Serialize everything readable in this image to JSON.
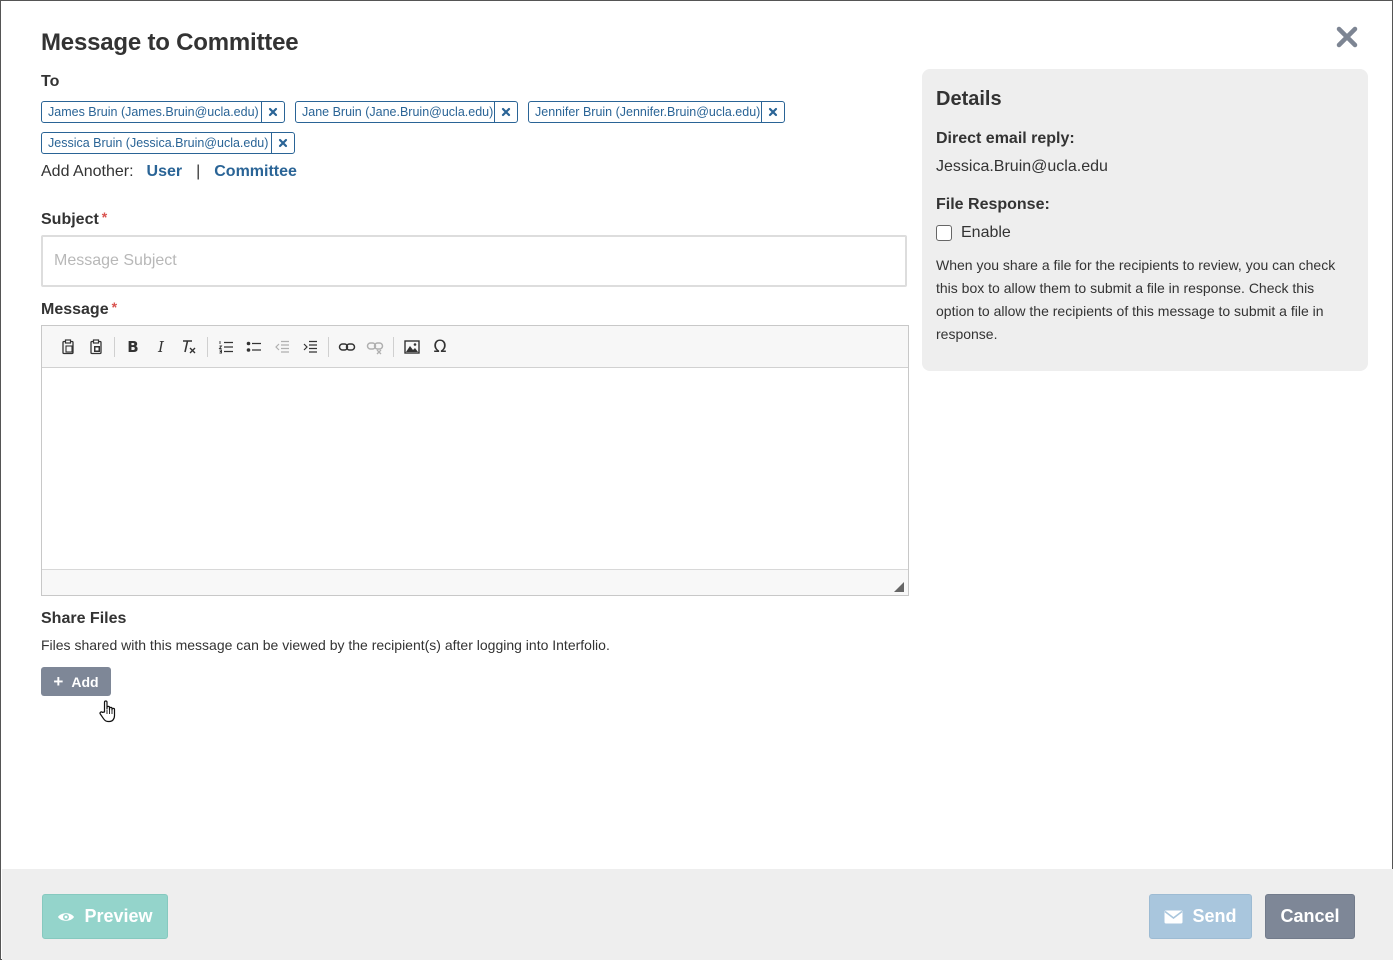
{
  "dialog": {
    "title": "Message to Committee",
    "close_icon": "close-icon"
  },
  "to": {
    "label": "To",
    "recipients": [
      {
        "text": "James Bruin (James.Bruin@ucla.edu)"
      },
      {
        "text": "Jane Bruin (Jane.Bruin@ucla.edu)"
      },
      {
        "text": "Jennifer Bruin (Jennifer.Bruin@ucla.edu)"
      },
      {
        "text": "Jessica Bruin (Jessica.Bruin@ucla.edu)"
      }
    ],
    "add_another_label": "Add Another:",
    "add_user_label": "User",
    "separator": "|",
    "add_committee_label": "Committee"
  },
  "subject": {
    "label": "Subject",
    "required_mark": "*",
    "value": "",
    "placeholder": "Message Subject"
  },
  "message": {
    "label": "Message",
    "required_mark": "*",
    "toolbar": {
      "bold": "B",
      "italic": "I",
      "special_char": "Ω"
    }
  },
  "share_files": {
    "title": "Share Files",
    "description": "Files shared with this message can be viewed by the recipient(s) after logging into Interfolio.",
    "add_label": "Add",
    "add_symbol": "+"
  },
  "details": {
    "title": "Details",
    "direct_reply_label": "Direct email reply:",
    "direct_reply_value": "Jessica.Bruin@ucla.edu",
    "file_response_label": "File Response:",
    "enable_label": "Enable",
    "enable_checked": false,
    "help_text": "When you share a file for the recipients to review, you can check this box to allow them to submit a file in response. Check this option to allow the recipients of this message to submit a file in response."
  },
  "footer": {
    "preview_label": "Preview",
    "send_label": "Send",
    "cancel_label": "Cancel"
  },
  "colors": {
    "link": "#2a6496",
    "required": "#d9534f",
    "preview_button": "#94d4cb",
    "send_button": "#a9c6dd",
    "cancel_button": "#7e8797",
    "panel_bg": "#eeeeee"
  }
}
